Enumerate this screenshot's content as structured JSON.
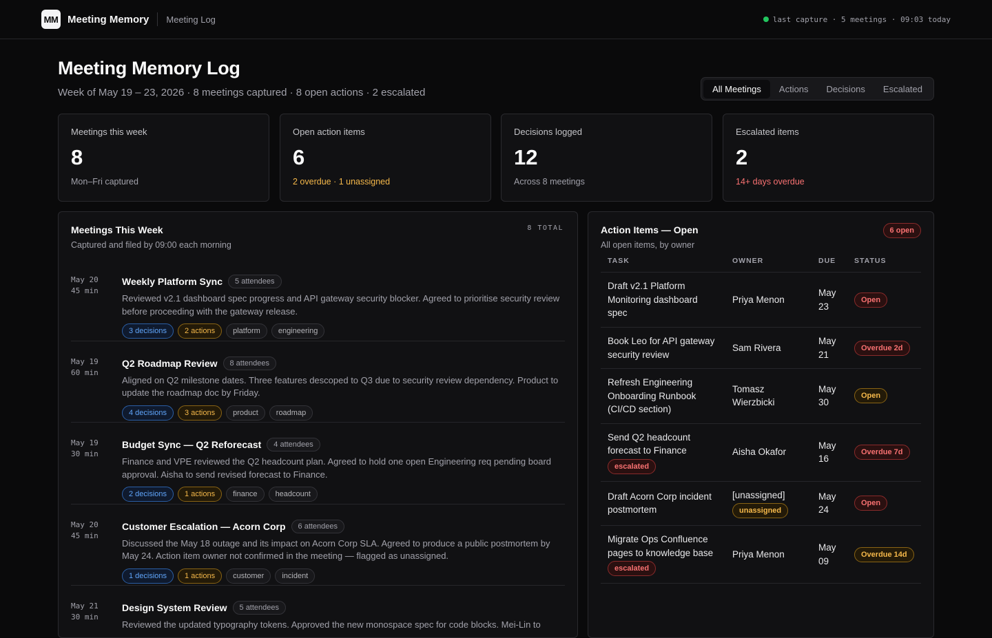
{
  "app": {
    "logo": "MM",
    "name": "Meeting Memory",
    "crumb": "Meeting Log",
    "status": "last capture · 5 meetings · 09:03 today",
    "status_color": "#22c55e"
  },
  "header": {
    "title": "Meeting Memory Log",
    "subtitle": "Week of May 19 – 23, 2026 · 8 meetings captured · 8 open actions · 2 escalated"
  },
  "tabs": [
    {
      "label": "All Meetings"
    },
    {
      "label": "Actions"
    },
    {
      "label": "Decisions"
    },
    {
      "label": "Escalated"
    }
  ],
  "stats": [
    {
      "label": "Meetings this week",
      "value": "8",
      "note": "Mon–Fri captured"
    },
    {
      "label": "Open action items",
      "value": "6",
      "note": "2 overdue · 1 unassigned"
    },
    {
      "label": "Decisions logged",
      "value": "12",
      "note": "Across 8 meetings"
    },
    {
      "label": "Escalated items",
      "value": "2",
      "note": "14+ days overdue"
    }
  ],
  "meetings_panel": {
    "title": "Meetings This Week",
    "subtitle": "Captured and filed by 09:00 each morning",
    "total": "8 TOTAL",
    "items": [
      {
        "date": "May 20",
        "duration": "45 min",
        "title": "Weekly Platform Sync",
        "attendees": "5 attendees",
        "desc": "Reviewed v2.1 dashboard spec progress and API gateway security blocker. Agreed to prioritise security review before proceeding with the gateway release.",
        "decisions": "3 decisions",
        "actions": "2 actions",
        "tags": [
          "platform",
          "engineering"
        ]
      },
      {
        "date": "May 19",
        "duration": "60 min",
        "title": "Q2 Roadmap Review",
        "attendees": "8 attendees",
        "desc": "Aligned on Q2 milestone dates. Three features descoped to Q3 due to security review dependency. Product to update the roadmap doc by Friday.",
        "decisions": "4 decisions",
        "actions": "3 actions",
        "tags": [
          "product",
          "roadmap"
        ]
      },
      {
        "date": "May 19",
        "duration": "30 min",
        "title": "Budget Sync — Q2 Reforecast",
        "attendees": "4 attendees",
        "desc": "Finance and VPE reviewed the Q2 headcount plan. Agreed to hold one open Engineering req pending board approval. Aisha to send revised forecast to Finance.",
        "decisions": "2 decisions",
        "actions": "1 actions",
        "tags": [
          "finance",
          "headcount"
        ]
      },
      {
        "date": "May 20",
        "duration": "45 min",
        "title": "Customer Escalation — Acorn Corp",
        "attendees": "6 attendees",
        "desc": "Discussed the May 18 outage and its impact on Acorn Corp SLA. Agreed to produce a public postmortem by May 24. Action item owner not confirmed in the meeting — flagged as unassigned.",
        "decisions": "1 decisions",
        "actions": "1 actions",
        "tags": [
          "customer",
          "incident"
        ]
      },
      {
        "date": "May 21",
        "duration": "30 min",
        "title": "Design System Review",
        "attendees": "5 attendees",
        "desc": "Reviewed the updated typography tokens. Approved the new monospace spec for code blocks. Mei-Lin to",
        "decisions": "",
        "actions": "",
        "tags": []
      }
    ]
  },
  "actions_panel": {
    "title": "Action Items — Open",
    "subtitle": "All open items, by owner",
    "badge": "6 open",
    "columns": [
      "TASK",
      "OWNER",
      "DUE",
      "STATUS"
    ],
    "rows": [
      {
        "task": "Draft v2.1 Platform Monitoring dashboard spec",
        "task_tag": "",
        "owner": "Priya Menon",
        "owner_tag": "",
        "due_m": "May",
        "due_d": "23",
        "status": "Open",
        "tone": "red"
      },
      {
        "task": "Book Leo for API gateway security review",
        "task_tag": "",
        "owner": "Sam Rivera",
        "owner_tag": "",
        "due_m": "May",
        "due_d": "21",
        "status": "Overdue 2d",
        "tone": "red"
      },
      {
        "task": "Refresh Engineering Onboarding Runbook (CI/CD section)",
        "task_tag": "",
        "owner": "Tomasz Wierzbicki",
        "owner_tag": "",
        "due_m": "May",
        "due_d": "30",
        "status": "Open",
        "tone": "amber"
      },
      {
        "task": "Send Q2 headcount forecast to Finance",
        "task_tag": "escalated",
        "owner": "Aisha Okafor",
        "owner_tag": "",
        "due_m": "May",
        "due_d": "16",
        "status": "Overdue 7d",
        "tone": "red"
      },
      {
        "task": "Draft Acorn Corp incident postmortem",
        "task_tag": "",
        "owner": "[unassigned]",
        "owner_tag": "unassigned",
        "due_m": "May",
        "due_d": "24",
        "status": "Open",
        "tone": "red"
      },
      {
        "task": "Migrate Ops Confluence pages to knowledge base",
        "task_tag": "escalated",
        "owner": "Priya Menon",
        "owner_tag": "",
        "due_m": "May",
        "due_d": "09",
        "status": "Overdue 14d",
        "tone": "amber"
      }
    ]
  }
}
